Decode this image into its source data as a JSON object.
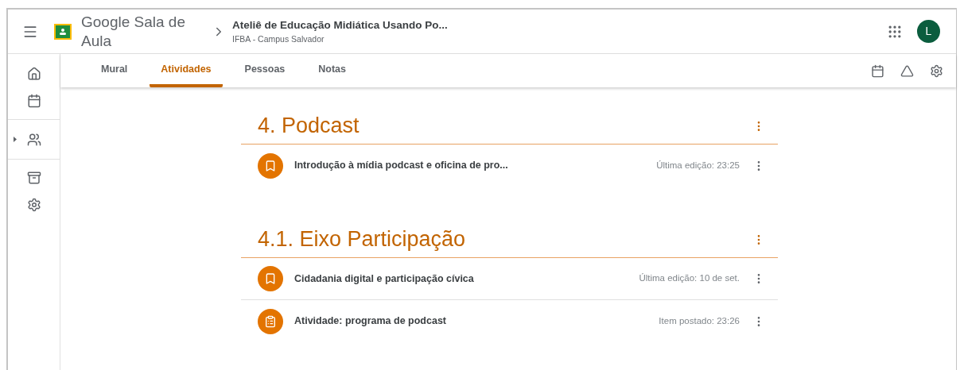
{
  "header": {
    "app_name": "Google Sala de Aula",
    "class_name": "Ateliê de Educação Midiática Usando Po...",
    "class_subtitle": "IFBA - Campus Salvador",
    "avatar_letter": "L"
  },
  "tabs": [
    {
      "label": "Mural",
      "selected": false
    },
    {
      "label": "Atividades",
      "selected": true
    },
    {
      "label": "Pessoas",
      "selected": false
    },
    {
      "label": "Notas",
      "selected": false
    }
  ],
  "topics": [
    {
      "title": "4. Podcast",
      "items": [
        {
          "kind": "material",
          "title": "Introdução à mídia podcast e oficina de pro...",
          "meta": "Última edição: 23:25"
        }
      ]
    },
    {
      "title": "4.1. Eixo Participação",
      "items": [
        {
          "kind": "material",
          "title": "Cidadania digital e participação cívica",
          "meta": "Última edição: 10 de set."
        },
        {
          "kind": "assignment",
          "title": "Atividade: programa de podcast",
          "meta": "Item postado: 23:26"
        }
      ]
    }
  ]
}
